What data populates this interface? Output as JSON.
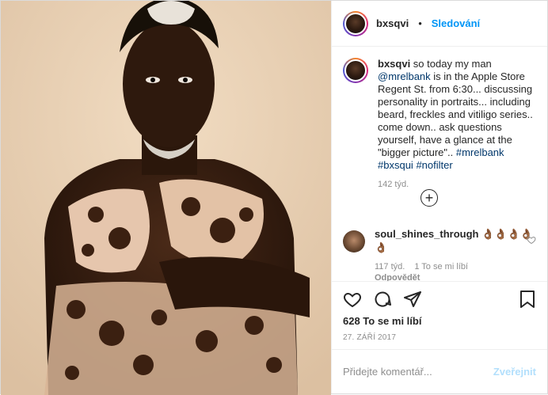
{
  "post": {
    "username": "bxsqvi",
    "dot": "•",
    "follow_label": "Sledování",
    "caption": {
      "username": "bxsqvi",
      "text_1": " so today my man ",
      "mention_1": "@mrelbank",
      "text_2": " is in the Apple Store Regent St. from 6:30... discussing personality in portraits... including beard, freckles and vitiligo series.. come down.. ask questions yourself, have a glance at the \"bigger picture\".. ",
      "hashtag_1": "#mrelbank",
      "hashtag_2": "#bxsqui",
      "hashtag_3": "#nofilter"
    },
    "caption_age": "142 týd.",
    "load_more_icon": "plus-circle-icon",
    "reply": {
      "username": "soul_shines_through",
      "emoji": "👌🏾👌🏾👌🏾👌🏾👌🏾",
      "age": "117 týd.",
      "likes": "1 To se mi líbí",
      "reply_label": "Odpovědět"
    },
    "likes_label": "628 To se mi líbí",
    "date": "27. ZÁŘÍ 2017",
    "comment_placeholder": "Přidejte komentář...",
    "post_label": "Zveřejnit",
    "icons": {
      "like": "heart-icon",
      "comment": "comment-icon",
      "share": "share-icon",
      "save": "bookmark-icon"
    }
  }
}
